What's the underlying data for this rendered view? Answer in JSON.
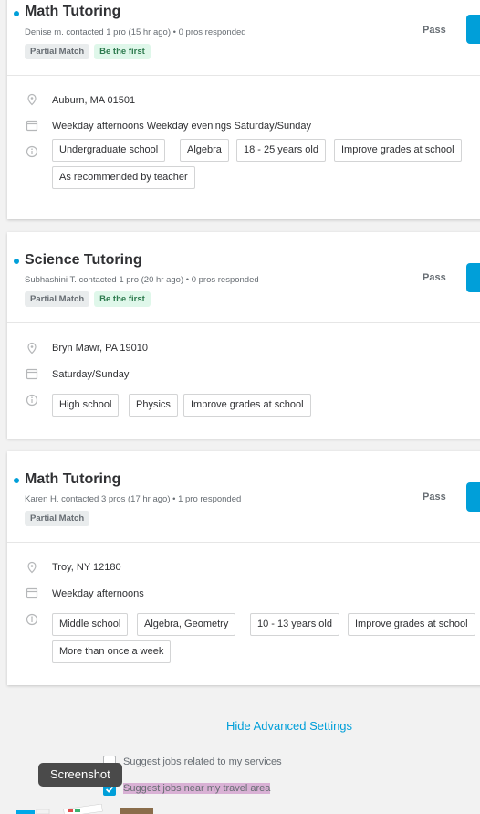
{
  "cards": [
    {
      "title": "Math Tutoring",
      "meta": "Denise m. contacted 1 pro (15 hr ago) • 0 pros responded",
      "badges": [
        "Partial Match",
        "Be the first"
      ],
      "pass_label": "Pass",
      "location": "Auburn, MA 01501",
      "schedule": "Weekday afternoons Weekday evenings Saturday/Sunday",
      "tags": [
        "Undergraduate school",
        "Algebra",
        "18 - 25 years old",
        "Improve grades at school",
        "As recommended by teacher"
      ]
    },
    {
      "title": "Science Tutoring",
      "meta": "Subhashini T. contacted 1 pro (20 hr ago) • 0 pros responded",
      "badges": [
        "Partial Match",
        "Be the first"
      ],
      "pass_label": "Pass",
      "location": "Bryn Mawr, PA 19010",
      "schedule": "Saturday/Sunday",
      "tags": [
        "High school",
        "Physics",
        "Improve grades at school"
      ]
    },
    {
      "title": "Math Tutoring",
      "meta": "Karen H. contacted 3 pros (17 hr ago) • 1 pro responded",
      "badges": [
        "Partial Match"
      ],
      "pass_label": "Pass",
      "location": "Troy, NY 12180",
      "schedule": "Weekday afternoons",
      "tags": [
        "Middle school",
        "Algebra, Geometry",
        "10 - 13 years old",
        "Improve grades at school",
        "More than once a week"
      ]
    }
  ],
  "settings": {
    "hide_link": "Hide Advanced Settings",
    "option_services": "Suggest jobs related to my services",
    "option_services_checked": false,
    "option_travel": "Suggest jobs near my travel area",
    "option_travel_checked": true
  },
  "tooltip": "Screenshot",
  "colors": {
    "accent": "#009fd9",
    "badge_green_bg": "#dff7ea",
    "highlight": "#d9b1d5"
  },
  "icons": {
    "location": "map-pin-icon",
    "schedule": "calendar-icon",
    "details": "info-icon"
  }
}
